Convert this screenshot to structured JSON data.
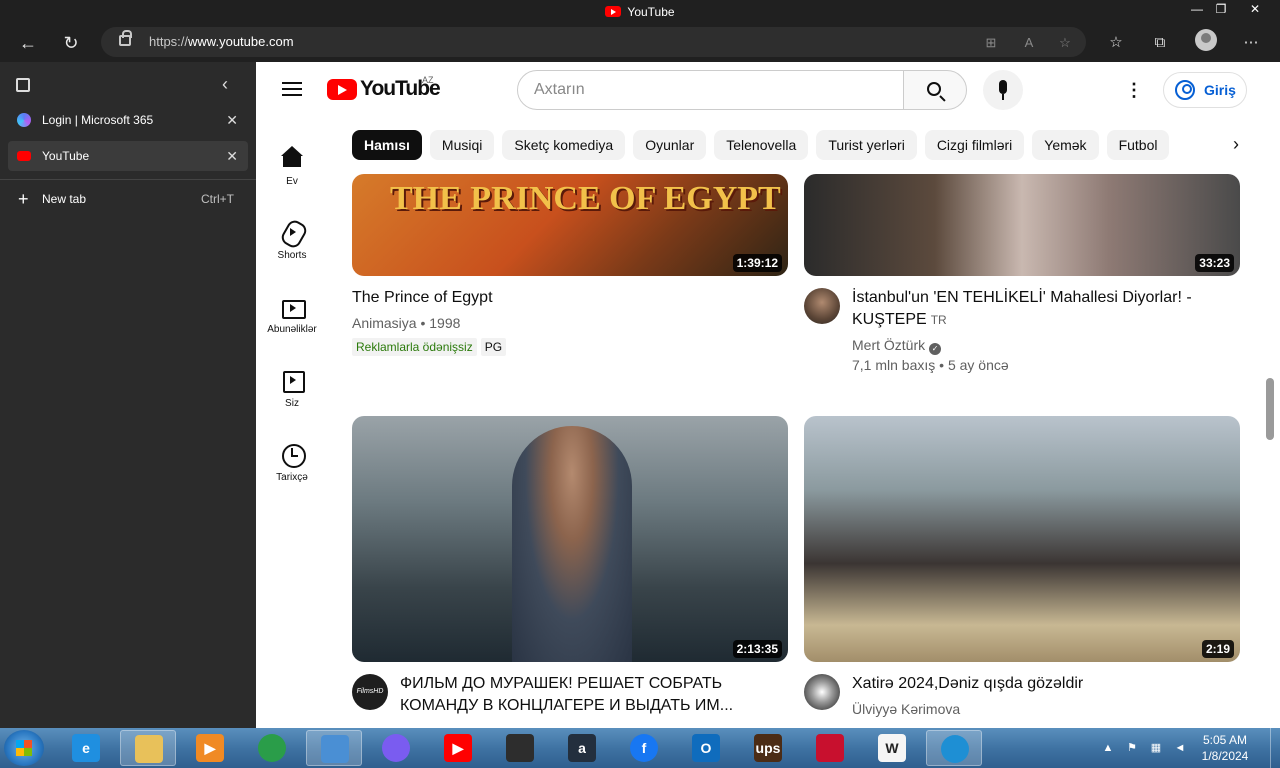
{
  "window": {
    "title": "YouTube",
    "minimize": "—",
    "restore": "❐",
    "close": "✕"
  },
  "browser": {
    "back": "←",
    "reload": "↻",
    "url_scheme": "https://",
    "url_host": "www.youtube.com",
    "more": "⋯"
  },
  "vertical_tabs": {
    "tabs": [
      {
        "label": "Login | Microsoft 365",
        "active": false
      },
      {
        "label": "YouTube",
        "active": true
      }
    ],
    "new_tab_label": "New tab",
    "new_tab_shortcut": "Ctrl+T",
    "close_glyph": "✕",
    "collapse_glyph": "‹"
  },
  "youtube": {
    "wordmark": "YouTube",
    "country": "AZ",
    "search_placeholder": "Axtarın",
    "signin_label": "Giriş",
    "kebab": "⋮",
    "chips": [
      "Hamısı",
      "Musiqi",
      "Sketç komediya",
      "Oyunlar",
      "Telenovella",
      "Turist yerləri",
      "Cizgi filmləri",
      "Yemək",
      "Futbol"
    ],
    "chip_next": "›",
    "guide": [
      {
        "label": "Ev",
        "icon": "home-icon"
      },
      {
        "label": "Shorts",
        "icon": "shorts-icon"
      },
      {
        "label": "Abunəliklər",
        "icon": "subscriptions-icon"
      },
      {
        "label": "Siz",
        "icon": "you-icon"
      },
      {
        "label": "Tarixçə",
        "icon": "history-icon"
      }
    ],
    "videos": [
      {
        "thumb_text": "THE PRINCE OF EGYPT",
        "duration": "1:39:12",
        "title": "The Prince of Egypt",
        "meta": "Animasiya • 1998",
        "badges": [
          "Reklamlarla ödənişsiz",
          "PG"
        ]
      },
      {
        "duration": "33:23",
        "title": "İstanbul'un 'EN TEHLİKELİ' Mahallesi Diyorlar! - KUŞTEPE",
        "title_tag": "TR",
        "channel": "Mert Öztürk",
        "stats": "7,1 mln baxış • 5 ay öncə"
      },
      {
        "duration": "2:13:35",
        "title": "ФИЛЬМ ДО МУРАШЕК! РЕШАЕТ СОБРАТЬ КОМАНДУ В КОНЦЛАГЕРЕ И ВЫДАТЬ ИМ...",
        "channel_avatar_text": "FilmsHD"
      },
      {
        "duration": "2:19",
        "title": "Xatirə 2024,Dəniz qışda gözəldir",
        "channel": "Ülviyyə Kərimova"
      }
    ]
  },
  "taskbar": {
    "apps": [
      {
        "name": "internet-explorer",
        "label": "e",
        "color": "#1f8fe0"
      },
      {
        "name": "file-explorer",
        "label": "",
        "color": "#e8c15a"
      },
      {
        "name": "media-player",
        "label": "▶",
        "color": "#f08a24"
      },
      {
        "name": "chrome",
        "label": "",
        "color": "#2a9d49"
      },
      {
        "name": "control-panel",
        "label": "",
        "color": "#4a8fd4"
      },
      {
        "name": "copilot",
        "label": "",
        "color": "#7a5cf0"
      },
      {
        "name": "youtube",
        "label": "▶",
        "color": "#ff0000"
      },
      {
        "name": "store",
        "label": "",
        "color": "#2d2d2d"
      },
      {
        "name": "amazon",
        "label": "a",
        "color": "#232f3e"
      },
      {
        "name": "facebook",
        "label": "f",
        "color": "#1877f2"
      },
      {
        "name": "outlook",
        "label": "O",
        "color": "#0f6cbd"
      },
      {
        "name": "ups",
        "label": "ups",
        "color": "#4b2c16"
      },
      {
        "name": "bank-of-america",
        "label": "",
        "color": "#c8102e"
      },
      {
        "name": "wikipedia",
        "label": "W",
        "color": "#f5f5f5"
      },
      {
        "name": "edge",
        "label": "",
        "color": "#1e8fd4"
      }
    ],
    "time": "5:05 AM",
    "date": "1/8/2024"
  }
}
